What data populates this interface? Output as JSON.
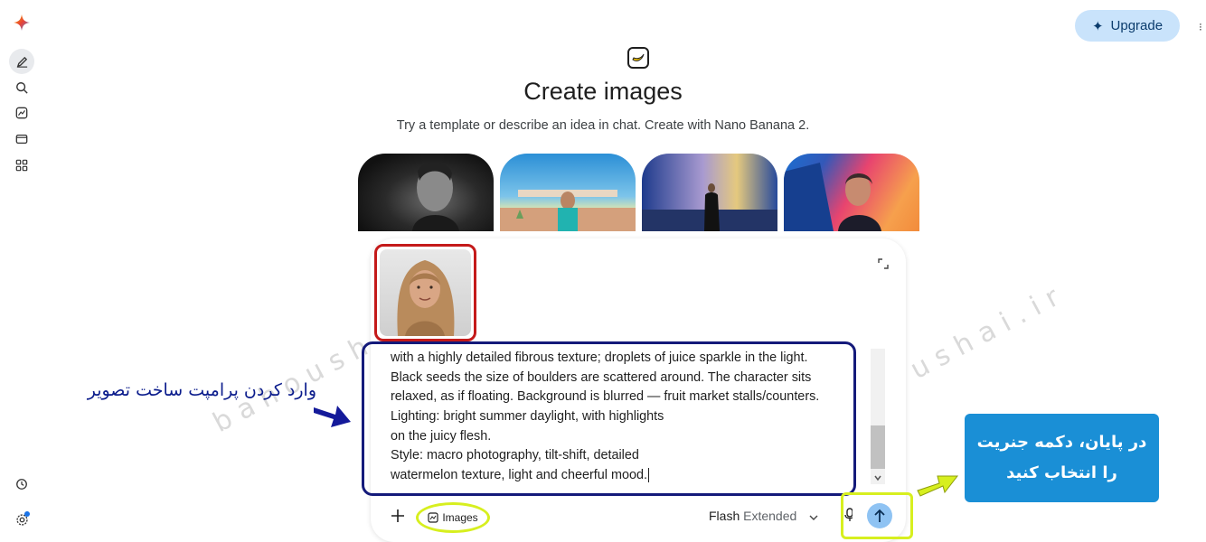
{
  "header": {
    "upgrade_label": "Upgrade"
  },
  "hero": {
    "title": "Create images",
    "subtitle": "Try a template or describe an idea in chat. Create with Nano Banana 2."
  },
  "prompt": {
    "lines": [
      "with a highly detailed fibrous texture; droplets of juice sparkle in the light.",
      "Black seeds the size of boulders are scattered around. The character sits",
      "relaxed, as if floating. Background is blurred — fruit market stalls/counters.",
      "Lighting: bright summer daylight, with highlights",
      "on the juicy flesh.",
      "Style: macro photography, tilt-shift, detailed",
      "watermelon texture, light and cheerful mood."
    ]
  },
  "toolbar": {
    "images_chip_label": "Images",
    "model_name": "Flash",
    "model_mode": "Extended"
  },
  "annotations": {
    "left_note": "وارد کردن پرامپت ساخت تصویر",
    "right_note_line1": "در پایان، دکمه جنریت",
    "right_note_line2": "را انتخاب کنید"
  },
  "watermark": "bahoushai.ir",
  "colors": {
    "prompt_frame": "#141a7a",
    "image_frame": "#c41a1a",
    "highlight": "#d7ef1f",
    "note_box": "#1a8fd6",
    "send_button": "#8fc3f3",
    "upgrade_bg": "#c9e3fb"
  }
}
